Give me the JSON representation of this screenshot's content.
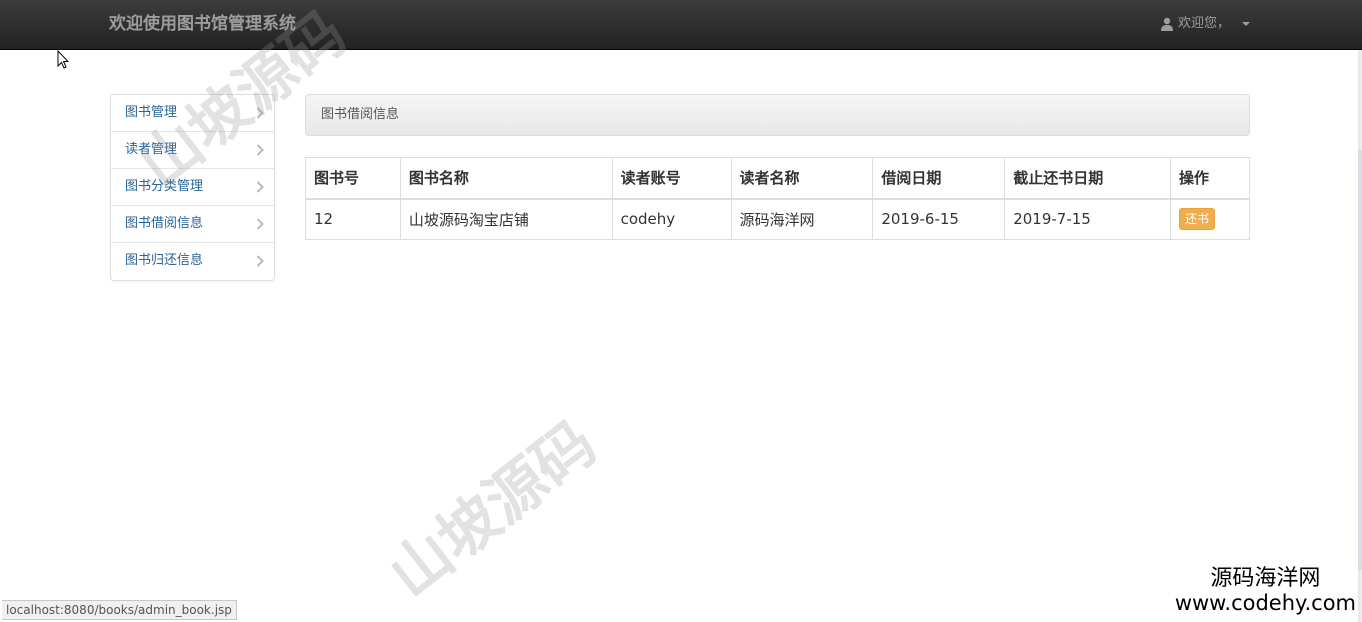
{
  "navbar": {
    "brand": "欢迎使用图书馆管理系统",
    "user_greeting": "欢迎您，"
  },
  "sidebar": {
    "items": [
      {
        "label": "图书管理"
      },
      {
        "label": "读者管理"
      },
      {
        "label": "图书分类管理"
      },
      {
        "label": "图书借阅信息"
      },
      {
        "label": "图书归还信息"
      }
    ]
  },
  "panel": {
    "title": "图书借阅信息"
  },
  "table": {
    "headers": [
      "图书号",
      "图书名称",
      "读者账号",
      "读者名称",
      "借阅日期",
      "截止还书日期",
      "操作"
    ],
    "rows": [
      {
        "book_id": "12",
        "book_name": "山坡源码淘宝店铺",
        "reader_account": "codehy",
        "reader_name": "源码海洋网",
        "borrow_date": "2019-6-15",
        "due_date": "2019-7-15",
        "action_label": "还书"
      }
    ]
  },
  "watermark": "山坡源码",
  "status_bar": {
    "url": "localhost:8080/books/admin_book.jsp"
  },
  "corner_brand": {
    "cn": "源码海洋网",
    "en": "www.codehy.com"
  },
  "colors": {
    "accent": "#2a6496",
    "warning": "#f0ad4e",
    "navbar": "#222222"
  }
}
